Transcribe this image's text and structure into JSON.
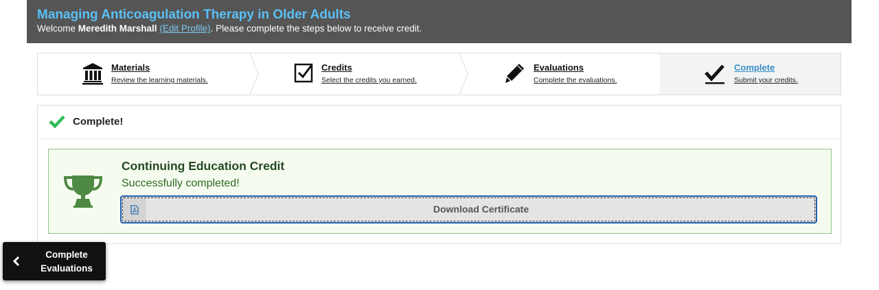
{
  "header": {
    "title": "Managing Anticoagulation Therapy in Older Adults",
    "welcome_prefix": "Welcome ",
    "user_name": "Meredith Marshall",
    "edit_profile": "(Edit Profile)",
    "welcome_suffix": ". Please complete the steps below to receive credit."
  },
  "steps": [
    {
      "label": "Materials",
      "sub": "Review the learning materials.",
      "icon": "bank-icon"
    },
    {
      "label": "Credits",
      "sub": "Select the credits you earned.",
      "icon": "checkbox-icon"
    },
    {
      "label": "Evaluations",
      "sub": "Complete the evaluations.",
      "icon": "pencil-icon"
    },
    {
      "label": "Complete",
      "sub": "Submit your credits.",
      "icon": "check-icon",
      "active": true
    }
  ],
  "panel": {
    "title": "Complete!",
    "credit_title": "Continuing Education Credit",
    "credit_message": "Successfully completed!",
    "download_label": "Download Certificate"
  },
  "back_button": {
    "line1": "Complete",
    "line2": "Evaluations"
  },
  "colors": {
    "header_bg": "#555555",
    "title": "#5bc0f5",
    "success_green": "#2dbb55",
    "trophy_green": "#4e8a43",
    "focus_blue": "#1d5fae"
  }
}
